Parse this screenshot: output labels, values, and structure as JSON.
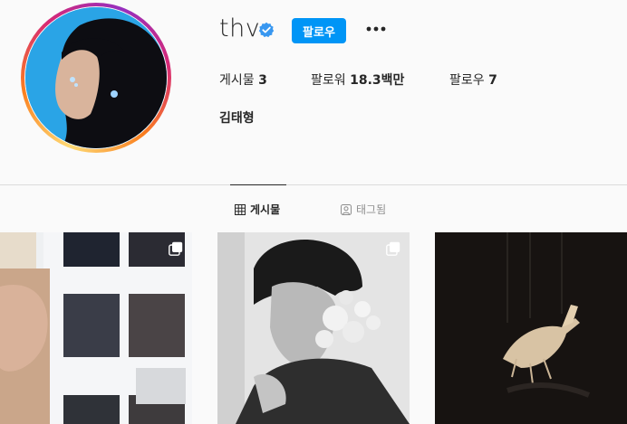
{
  "profile": {
    "username": "thv",
    "follow_label": "팔로우",
    "full_name": "김태형",
    "stats": {
      "posts_label": "게시물",
      "posts_value": "3",
      "followers_label": "팔로워",
      "followers_value": "18.3백만",
      "following_label": "팔로우",
      "following_value": "7"
    }
  },
  "tabs": [
    {
      "label": "게시물",
      "icon": "grid-icon",
      "active": true
    },
    {
      "label": "태그됨",
      "icon": "tagged-icon",
      "active": false
    }
  ],
  "posts": [
    {
      "icon": "carousel-icon"
    },
    {
      "icon": "carousel-icon"
    },
    {
      "icon": null
    }
  ],
  "colors": {
    "accent": "#0095f6",
    "verified": "#3897f0",
    "text": "#262626",
    "muted": "#8e8e8e",
    "background": "#fafafa"
  },
  "icons": {
    "verified": "verified-badge-icon",
    "more": "more-options-icon"
  }
}
